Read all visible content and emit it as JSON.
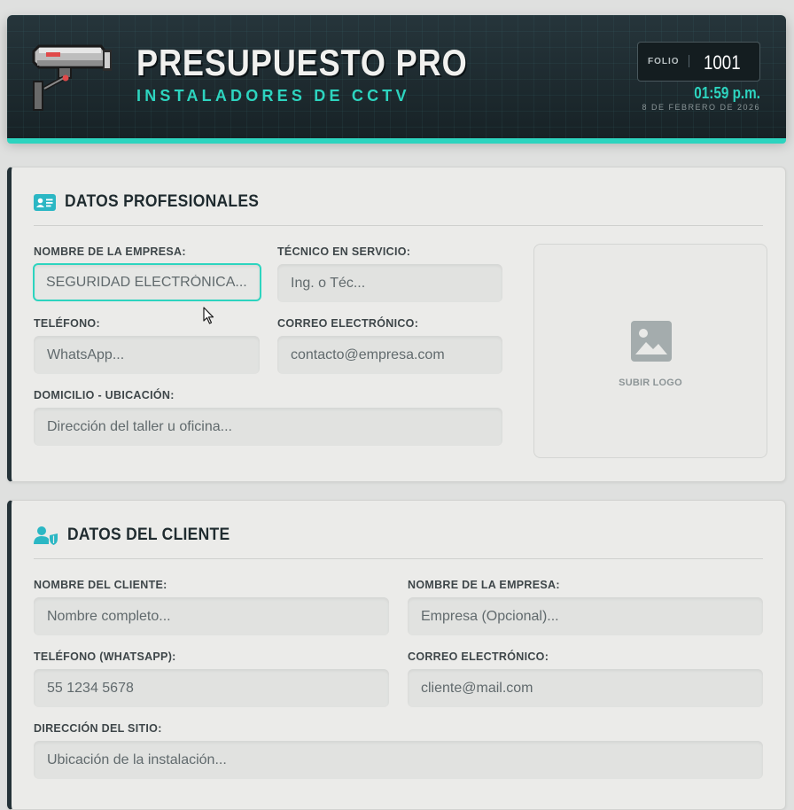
{
  "header": {
    "title": "PRESUPUESTO PRO",
    "subtitle": "INSTALADORES DE CCTV",
    "folio_label": "FOLIO",
    "folio_value": "1001",
    "time": "01:59 p.m.",
    "date": "8 DE FEBRERO DE 2026",
    "icon": "cctv-camera-icon",
    "accent_color": "#2dd4bf"
  },
  "professional": {
    "title": "DATOS PROFESIONALES",
    "icon": "id-card-icon",
    "company_label": "NOMBRE DE LA EMPRESA:",
    "company_placeholder": "SEGURIDAD ELECTRÓNICA...",
    "technician_label": "TÉCNICO EN SERVICIO:",
    "technician_placeholder": "Ing. o Téc...",
    "phone_label": "TELÉFONO:",
    "phone_placeholder": "WhatsApp...",
    "email_label": "CORREO ELECTRÓNICO:",
    "email_placeholder": "contacto@empresa.com",
    "address_label": "DOMICILIO - UBICACIÓN:",
    "address_placeholder": "Dirección del taller u oficina...",
    "logo_label": "SUBIR LOGO",
    "logo_icon": "image-icon"
  },
  "client": {
    "title": "DATOS DEL CLIENTE",
    "icon": "user-shield-icon",
    "name_label": "NOMBRE DEL CLIENTE:",
    "name_placeholder": "Nombre completo...",
    "company_label": "NOMBRE DE LA EMPRESA:",
    "company_placeholder": "Empresa (Opcional)...",
    "phone_label": "TELÉFONO (WHATSAPP):",
    "phone_placeholder": "55 1234 5678",
    "email_label": "CORREO ELECTRÓNICO:",
    "email_placeholder": "cliente@mail.com",
    "site_label": "DIRECCIÓN DEL SITIO:",
    "site_placeholder": "Ubicación de la instalación..."
  }
}
